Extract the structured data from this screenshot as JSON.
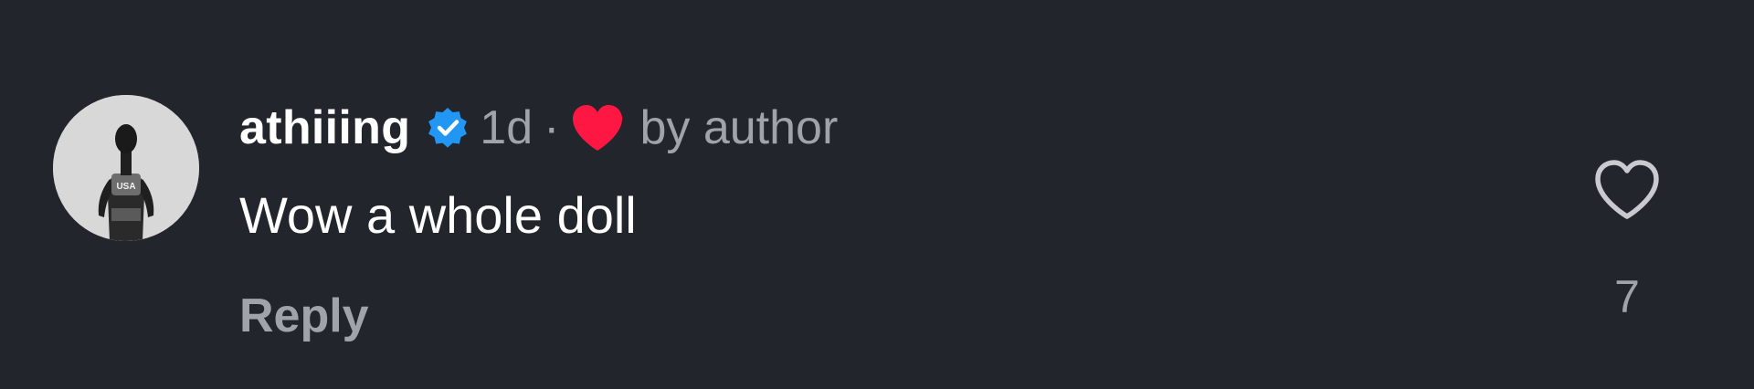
{
  "comment": {
    "username": "athiiing",
    "verified": true,
    "time": "1d",
    "separator": "·",
    "liked_by_author_label": "by author",
    "text": "Wow a whole doll",
    "reply_label": "Reply",
    "like_count": "7",
    "avatar_jersey_text": "USA"
  },
  "colors": {
    "background": "#23252c",
    "username": "#ffffff",
    "secondary_text": "#a0a3aa",
    "verified_badge": "#2196f3",
    "author_heart": "#ff1744"
  },
  "icons": {
    "verified": "verified-badge-icon",
    "author_like": "heart-filled-icon",
    "like": "heart-outline-icon"
  }
}
